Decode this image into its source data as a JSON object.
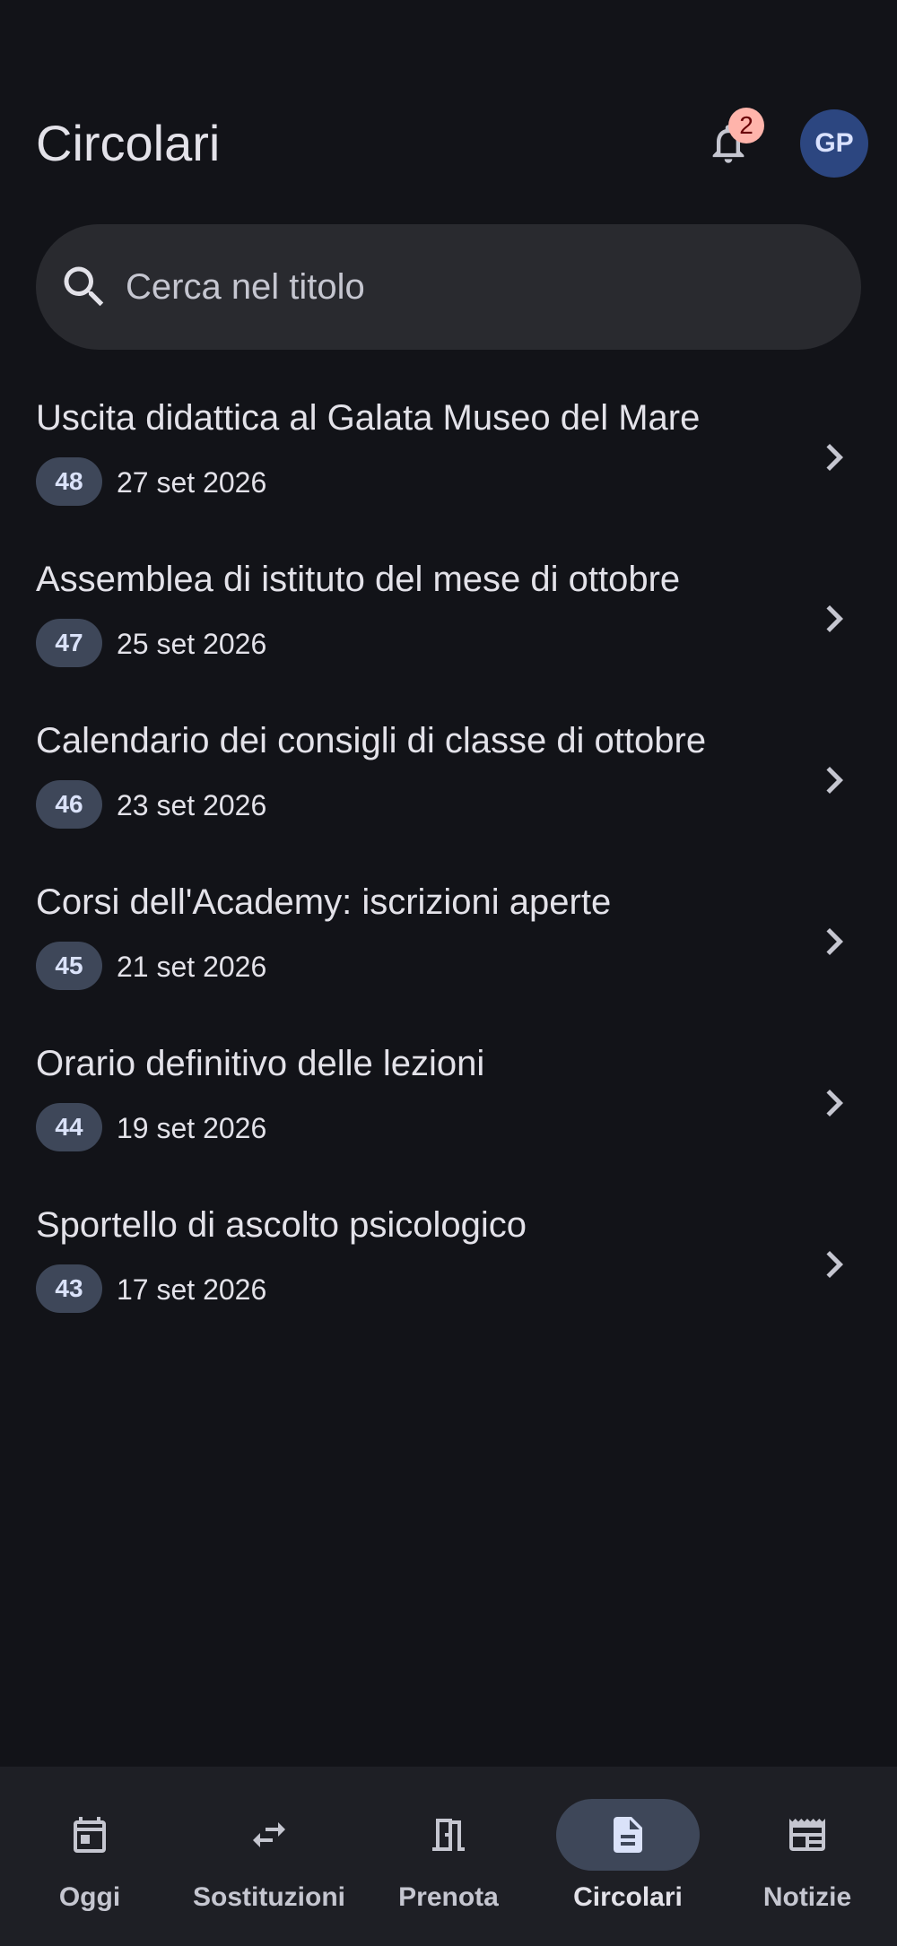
{
  "header": {
    "title": "Circolari",
    "notification_count": "2",
    "avatar_initials": "GP"
  },
  "search": {
    "placeholder": "Cerca nel titolo",
    "value": ""
  },
  "circolari": [
    {
      "title": "Uscita didattica al Galata Museo del Mare",
      "number": "48",
      "date": "27 set 2026"
    },
    {
      "title": "Assemblea di istituto del mese di ottobre",
      "number": "47",
      "date": "25 set 2026"
    },
    {
      "title": "Calendario dei consigli di classe di ottobre",
      "number": "46",
      "date": "23 set 2026"
    },
    {
      "title": "Corsi dell'Academy: iscrizioni aperte",
      "number": "45",
      "date": "21 set 2026"
    },
    {
      "title": "Orario definitivo delle lezioni",
      "number": "44",
      "date": "19 set 2026"
    },
    {
      "title": "Sportello di ascolto psicologico",
      "number": "43",
      "date": "17 set 2026"
    }
  ],
  "nav": {
    "items": [
      {
        "label": "Oggi",
        "icon": "calendar-icon"
      },
      {
        "label": "Sostituzioni",
        "icon": "swap-icon"
      },
      {
        "label": "Prenota",
        "icon": "door-icon"
      },
      {
        "label": "Circolari",
        "icon": "document-icon"
      },
      {
        "label": "Notizie",
        "icon": "newspaper-icon"
      }
    ],
    "active": "Circolari"
  },
  "colors": {
    "background": "#121318",
    "surface": "#1e1f25",
    "search_bg": "#292a2f",
    "chip_bg": "#3e4759",
    "badge_bg": "#ffb4ab",
    "avatar_bg": "#2c4680",
    "text": "#e3e2e9"
  }
}
